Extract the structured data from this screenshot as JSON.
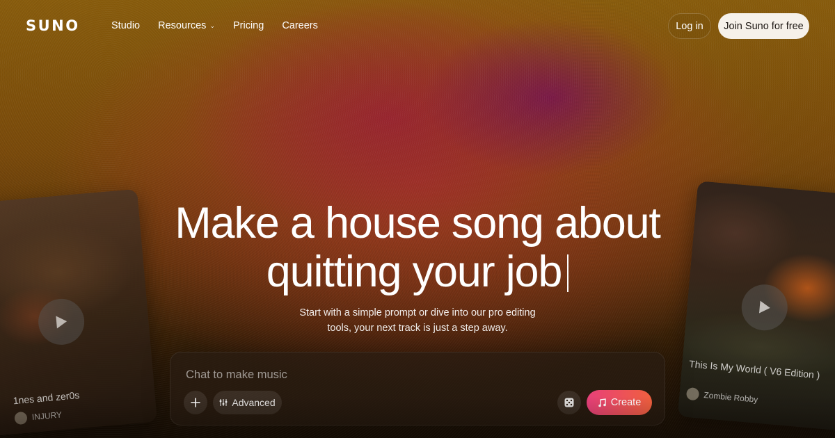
{
  "nav": {
    "logo": "SUNO",
    "links": [
      {
        "label": "Studio"
      },
      {
        "label": "Resources",
        "has_dropdown": true
      },
      {
        "label": "Pricing"
      },
      {
        "label": "Careers"
      }
    ],
    "login_label": "Log in",
    "join_label": "Join Suno for free"
  },
  "hero": {
    "title_line1": "Make a house song about",
    "title_line2": "quitting your job",
    "subtitle_line1": "Start with a simple prompt or dive into our pro editing",
    "subtitle_line2": "tools, your next track is just a step away."
  },
  "prompt": {
    "placeholder": "Chat to make music",
    "value": "",
    "advanced_label": "Advanced",
    "create_label": "Create",
    "icons": {
      "add": "plus-icon",
      "advanced": "sliders-icon",
      "random": "dice-icon",
      "create": "music-note-icon"
    }
  },
  "cards": {
    "left": {
      "title": "1nes and zer0s",
      "artist": "INJURY"
    },
    "right": {
      "title": "This Is My World ( V6 Edition )",
      "artist": "Zombie Robby"
    }
  },
  "colors": {
    "join_bg": "#f6f1ea",
    "create_gradient_start": "#e8407a",
    "create_gradient_end": "#f0603e"
  }
}
